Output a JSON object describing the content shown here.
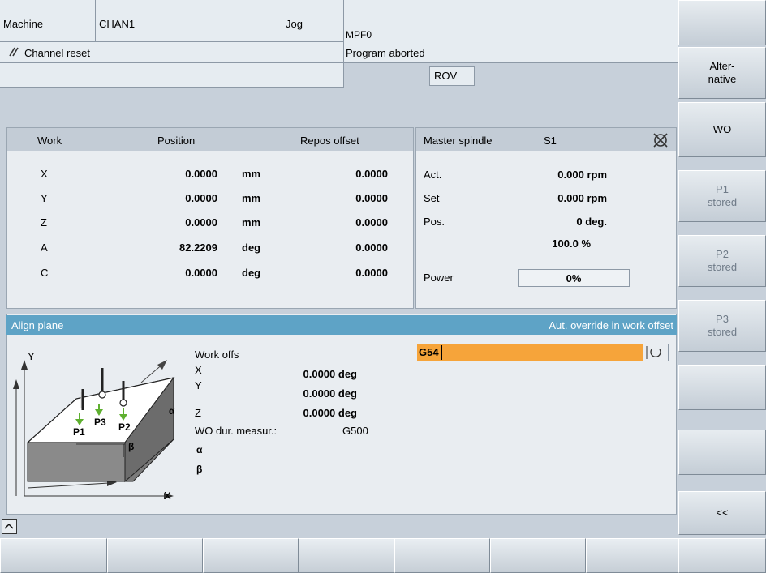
{
  "header": {
    "area": "Machine",
    "channel": "CHAN1",
    "mode": "Jog",
    "program": "MPF0",
    "reset_msg": "Channel reset",
    "prog_status": "Program aborted",
    "rov": "ROV"
  },
  "work_table": {
    "headers": [
      "Work",
      "Position",
      "Repos offset"
    ],
    "rows": [
      {
        "axis": "X",
        "pos": "0.0000",
        "unit": "mm",
        "repos": "0.0000"
      },
      {
        "axis": "Y",
        "pos": "0.0000",
        "unit": "mm",
        "repos": "0.0000"
      },
      {
        "axis": "Z",
        "pos": "0.0000",
        "unit": "mm",
        "repos": "0.0000"
      },
      {
        "axis": "A",
        "pos": "82.2209",
        "unit": "deg",
        "repos": "0.0000"
      },
      {
        "axis": "C",
        "pos": "0.0000",
        "unit": "deg",
        "repos": "0.0000"
      }
    ]
  },
  "spindle": {
    "title": "Master spindle",
    "name": "S1",
    "act_label": "Act.",
    "act_val": "0.000 rpm",
    "set_label": "Set",
    "set_val": "0.000 rpm",
    "pos_label": "Pos.",
    "pos_val": "0 deg.",
    "override": "100.0 %",
    "power_label": "Power",
    "power_val": "0%",
    "power_fraction": 0.0
  },
  "align": {
    "title": "Align plane",
    "right_title": "Aut. override in work offset",
    "work_offs": "Work offs",
    "x_label": "X",
    "x_val": "0.0000 deg",
    "y_label": "Y",
    "y_val": "0.0000 deg",
    "z_label": "Z",
    "z_val": "0.0000 deg",
    "wo_label": "WO dur. measur.:",
    "wo_val": "G500",
    "alpha": "α",
    "beta": "β",
    "input_value": "G54",
    "diagram": {
      "y": "Y",
      "x": "X",
      "p1": "P1",
      "p2": "P2",
      "p3": "P3",
      "a": "α",
      "b": "β"
    }
  },
  "softkeys_v": [
    {
      "label": "",
      "dim": false
    },
    {
      "label": "Alter-\nnative",
      "dim": false
    },
    {
      "label": "WO",
      "dim": false
    },
    {
      "label": "P1\nstored",
      "dim": true
    },
    {
      "label": "P2\nstored",
      "dim": true
    },
    {
      "label": "P3\nstored",
      "dim": true
    },
    {
      "label": "",
      "dim": false
    },
    {
      "label": "",
      "dim": false
    },
    {
      "label": "<<",
      "dim": false
    }
  ]
}
